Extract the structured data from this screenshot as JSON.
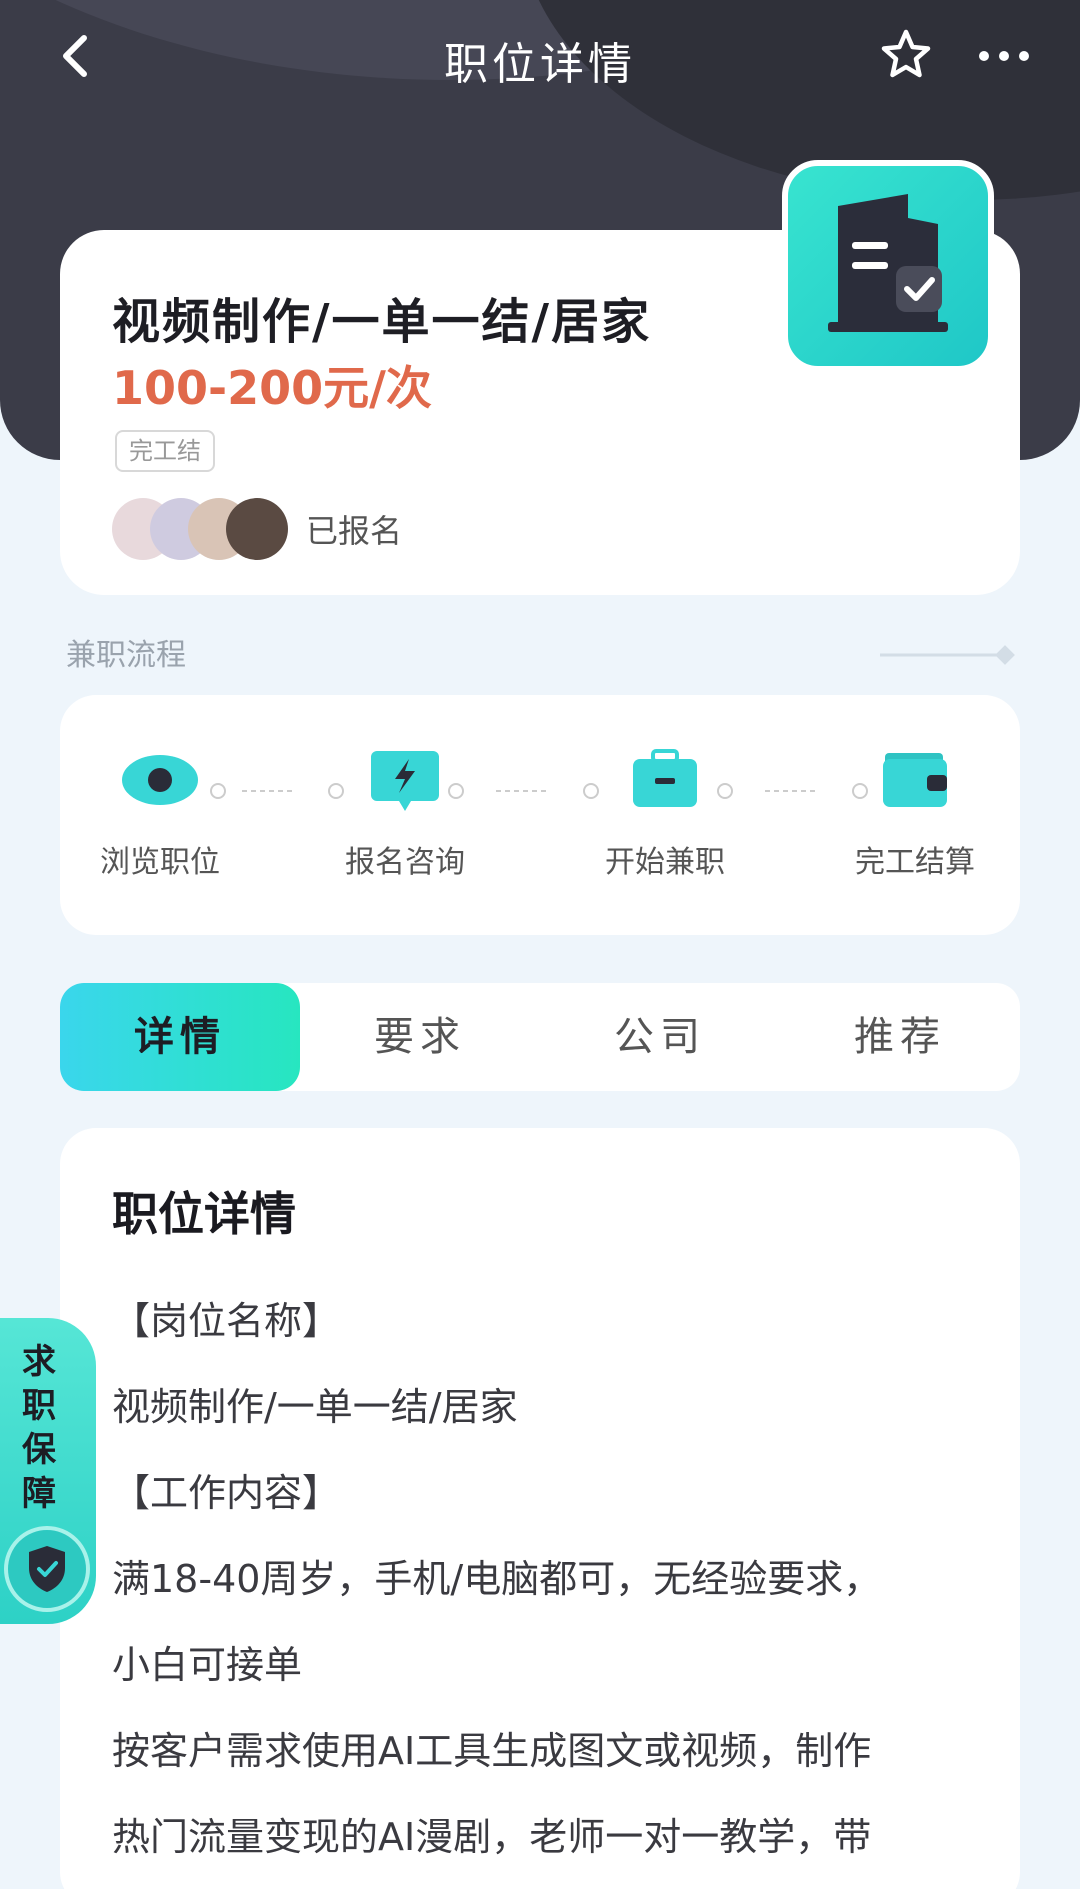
{
  "header": {
    "title": "职位详情"
  },
  "job": {
    "title": "视频制作/一单一结/居家",
    "salary": "100-200元/次",
    "tag": "完工结",
    "signed_text": "已报名"
  },
  "process": {
    "label": "兼职流程",
    "steps": [
      {
        "label": "浏览职位",
        "icon": "eye-icon"
      },
      {
        "label": "报名咨询",
        "icon": "chat-bolt-icon"
      },
      {
        "label": "开始兼职",
        "icon": "briefcase-icon"
      },
      {
        "label": "完工结算",
        "icon": "wallet-icon"
      }
    ]
  },
  "tabs": [
    {
      "label": "详情",
      "active": true
    },
    {
      "label": "要求",
      "active": false
    },
    {
      "label": "公司",
      "active": false
    },
    {
      "label": "推荐",
      "active": false
    }
  ],
  "detail": {
    "heading": "职位详情",
    "lines": [
      "【岗位名称】",
      "视频制作/一单一结/居家",
      "【工作内容】",
      "满18-40周岁，手机/电脑都可，无经验要求，",
      "小白可接单",
      "按客户需求使用AI工具生成图文或视频，制作",
      "热门流量变现的AI漫剧，老师一对一教学，带"
    ]
  },
  "guarantee": {
    "text": "求职保障"
  },
  "colors": {
    "accent": "#27e6c0",
    "salary": "#e0694b",
    "header_bg": "#3b3c48"
  }
}
